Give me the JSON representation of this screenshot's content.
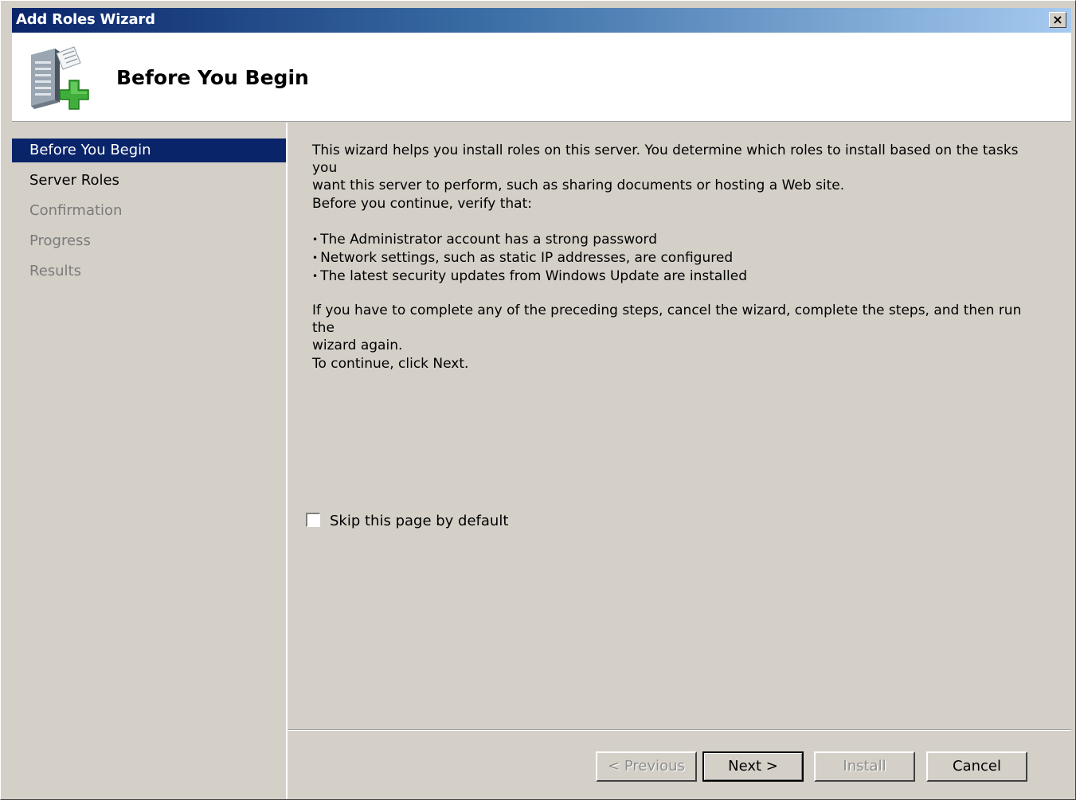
{
  "window": {
    "title": "Add Roles Wizard",
    "close_label": "×"
  },
  "header": {
    "icon": "server-roles-wizard-icon",
    "page_title": "Before You Begin"
  },
  "sidebar": {
    "items": [
      {
        "label": "Before You Begin",
        "state": "active"
      },
      {
        "label": "Server Roles",
        "state": "enabled"
      },
      {
        "label": "Confirmation",
        "state": "disabled"
      },
      {
        "label": "Progress",
        "state": "disabled"
      },
      {
        "label": "Results",
        "state": "disabled"
      }
    ]
  },
  "content": {
    "intro_line1": "This wizard helps you install roles on this server. You determine which roles to install based on the tasks you",
    "intro_line2": "want this server to perform, such as sharing documents or hosting a Web site.",
    "verify": "Before you continue, verify that:",
    "bullets": [
      "The Administrator account has a strong password",
      "Network settings, such as static IP addresses, are configured",
      "The latest security updates from Windows Update are installed"
    ],
    "preceding_line1": "If you have to complete any of the preceding steps, cancel the wizard, complete the steps, and then run the",
    "preceding_line2": "wizard again.",
    "continue": "To continue, click Next.",
    "skip_label": "Skip this page by default",
    "skip_checked": false
  },
  "footer": {
    "previous_label": "< Previous",
    "next_label": "Next >",
    "install_label": "Install",
    "cancel_label": "Cancel"
  },
  "colors": {
    "title_gradient_start": "#0a246a",
    "title_gradient_end": "#a6caf0",
    "selected_item_bg": "#0a246a",
    "face": "#d4d0c8"
  }
}
